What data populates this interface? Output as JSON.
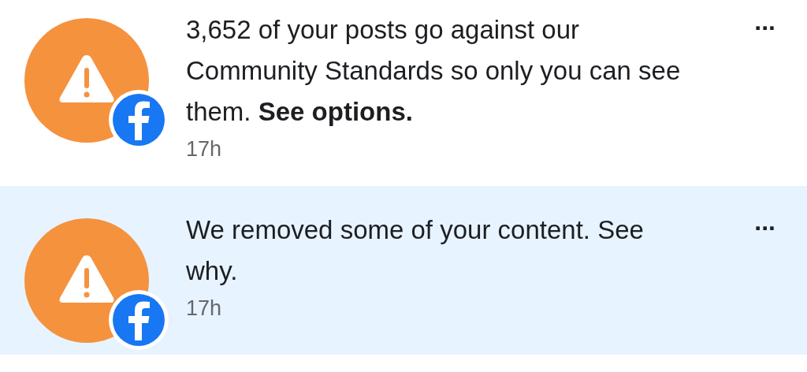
{
  "notifications": [
    {
      "text": "3,652 of your posts go against our Community Standards so only you can see them. **See options.**",
      "time": "17h",
      "unread": false,
      "menu": "..."
    },
    {
      "text": "We removed some of your content. See why.",
      "time": "17h",
      "unread": true,
      "menu": "..."
    }
  ]
}
